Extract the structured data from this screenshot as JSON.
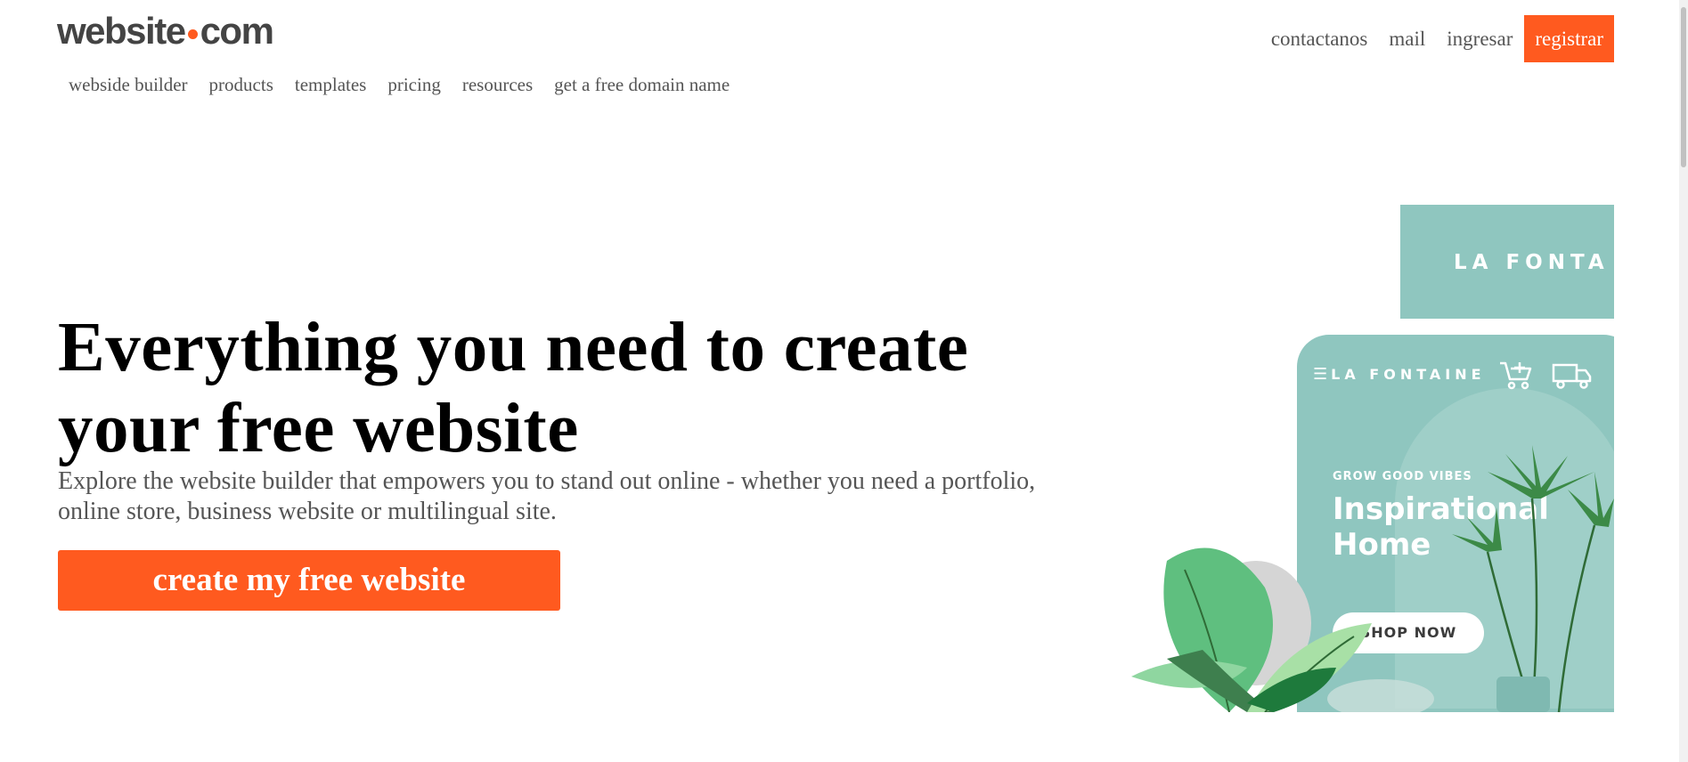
{
  "logo": {
    "part1": "website",
    "part2": "com",
    "dot_color": "#ff5a1f"
  },
  "topnav": {
    "links": [
      "contactanos",
      "mail",
      "ingresar"
    ],
    "register_label": "registrar"
  },
  "mainnav": {
    "items": [
      "webside builder",
      "products",
      "templates",
      "pricing",
      "resources",
      "get a free domain name"
    ]
  },
  "hero": {
    "title": "Everything you need to create your free website",
    "subtitle": "Explore the website builder that empowers you to stand out online - whether you need a portfolio, online store, business website or multilingual site.",
    "cta_label": "create my free website"
  },
  "illustration": {
    "banner_brand": "LA FONTA",
    "phone_brand": "LA FONTAINE",
    "eyebrow": "GROW GOOD VIBES",
    "headline": "Inspirational Home",
    "shop_button": "SHOP NOW",
    "icons": [
      "menu-icon",
      "cart-icon",
      "truck-icon"
    ]
  },
  "colors": {
    "accent": "#ff5a1f",
    "teal": "#8fc6bf"
  }
}
